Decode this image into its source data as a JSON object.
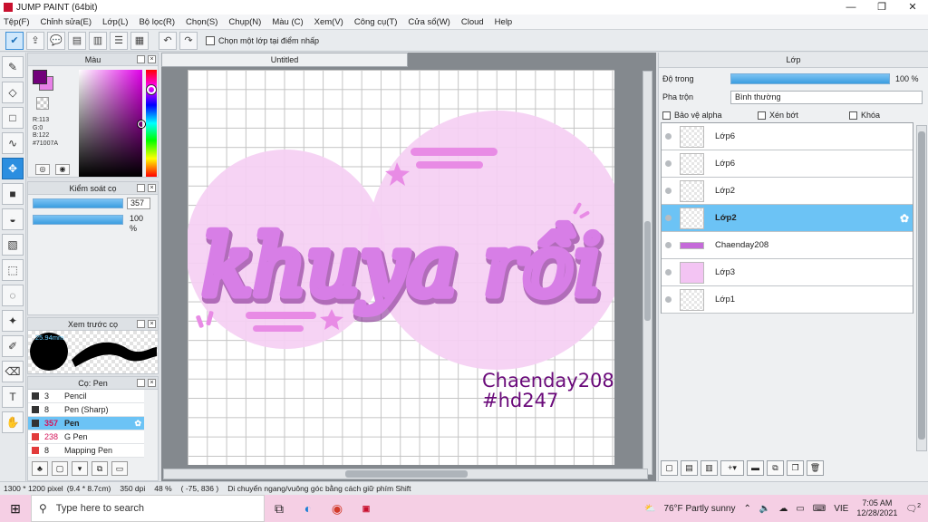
{
  "window": {
    "title": "JUMP PAINT (64bit)",
    "controls": [
      "—",
      "❐",
      "✕"
    ]
  },
  "menu": [
    "Tệp(F)",
    "Chỉnh sửa(E)",
    "Lớp(L)",
    "Bộ lọc(R)",
    "Chọn(S)",
    "Chụp(N)",
    "Màu (C)",
    "Xem(V)",
    "Công cụ(T)",
    "Cửa sổ(W)",
    "Cloud",
    "Help"
  ],
  "toolbar": {
    "pick_layer_label": "Chọn một lớp tại điểm nhấp"
  },
  "color_panel": {
    "title": "Màu",
    "fg": "#71007a",
    "bg": "#e87fe8",
    "rgb": [
      "R:113",
      "G:0",
      "B:122",
      "#71007A"
    ]
  },
  "brush_control": {
    "title": "Kiểm soát cọ",
    "size": "357",
    "opacity": "100 %"
  },
  "preview": {
    "title": "Xem trước cọ",
    "size": "25.94mm"
  },
  "brush_list": {
    "title": "Cọ: Pen",
    "items": [
      {
        "num": "3",
        "name": "Pencil"
      },
      {
        "num": "8",
        "name": "Pen (Sharp)"
      },
      {
        "num": "357",
        "name": "Pen"
      },
      {
        "num": "238",
        "name": "G Pen"
      },
      {
        "num": "8",
        "name": "Mapping Pen"
      }
    ]
  },
  "document": {
    "tab": "Untitled",
    "artwork": {
      "title": "khuya rồi",
      "credit": "Chaenday208",
      "tag": "#hd247"
    }
  },
  "layer_panel": {
    "title": "Lớp",
    "opacity_label": "Độ trong",
    "opacity_value": "100 %",
    "blend_label": "Pha trộn",
    "blend_value": "Bình thường",
    "protect_alpha": "Bảo vệ alpha",
    "clipping": "Xén bớt",
    "lock": "Khóa",
    "layers": [
      "Lớp6",
      "Lớp6",
      "Lớp2",
      "Lớp2",
      "Chaenday208",
      "Lớp3",
      "Lớp1"
    ]
  },
  "status": {
    "size": "1300 * 1200 pixel",
    "cm": "(9.4 * 8.7cm)",
    "dpi": "350 dpi",
    "zoom": "48 %",
    "pos": "( -75, 836 )",
    "hint": "Di chuyển ngang/vuông góc bằng cách giữ phím Shift"
  },
  "taskbar": {
    "search_placeholder": "Type here to search",
    "weather": "76°F  Partly sunny",
    "lang": "VIE",
    "time": "7:05 AM",
    "date": "12/28/2021",
    "notif": "2"
  }
}
